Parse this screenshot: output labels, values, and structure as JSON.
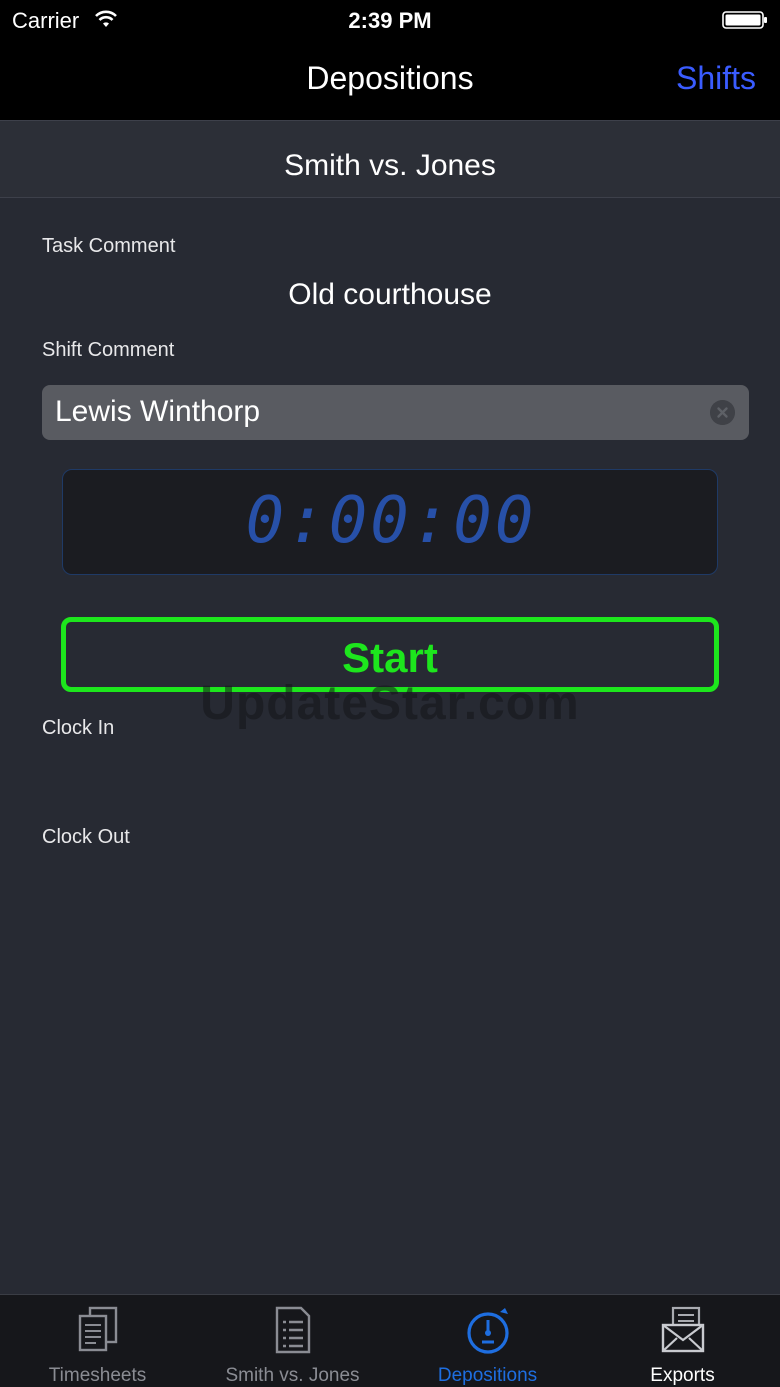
{
  "status_bar": {
    "carrier": "Carrier",
    "time": "2:39 PM"
  },
  "nav": {
    "title": "Depositions",
    "right_button": "Shifts"
  },
  "sub_header": {
    "title": "Smith vs. Jones"
  },
  "form": {
    "task_comment_label": "Task Comment",
    "task_comment_value": "Old courthouse",
    "shift_comment_label": "Shift Comment",
    "shift_comment_value": "Lewis Winthorp",
    "timer": "0:00:00",
    "start_label": "Start",
    "clock_in_label": "Clock In",
    "clock_out_label": "Clock Out"
  },
  "watermark": "UpdateStar.com",
  "tabs": [
    {
      "label": "Timesheets",
      "icon": "documents-icon"
    },
    {
      "label": "Smith vs. Jones",
      "icon": "list-document-icon"
    },
    {
      "label": "Depositions",
      "icon": "stopwatch-icon",
      "active": true
    },
    {
      "label": "Exports",
      "icon": "envelope-export-icon"
    }
  ],
  "colors": {
    "accent_blue": "#3a5cff",
    "active_tab_blue": "#1e6ee0",
    "start_green": "#1de61d",
    "timer_blue": "#2750a8",
    "background": "#272a33"
  }
}
